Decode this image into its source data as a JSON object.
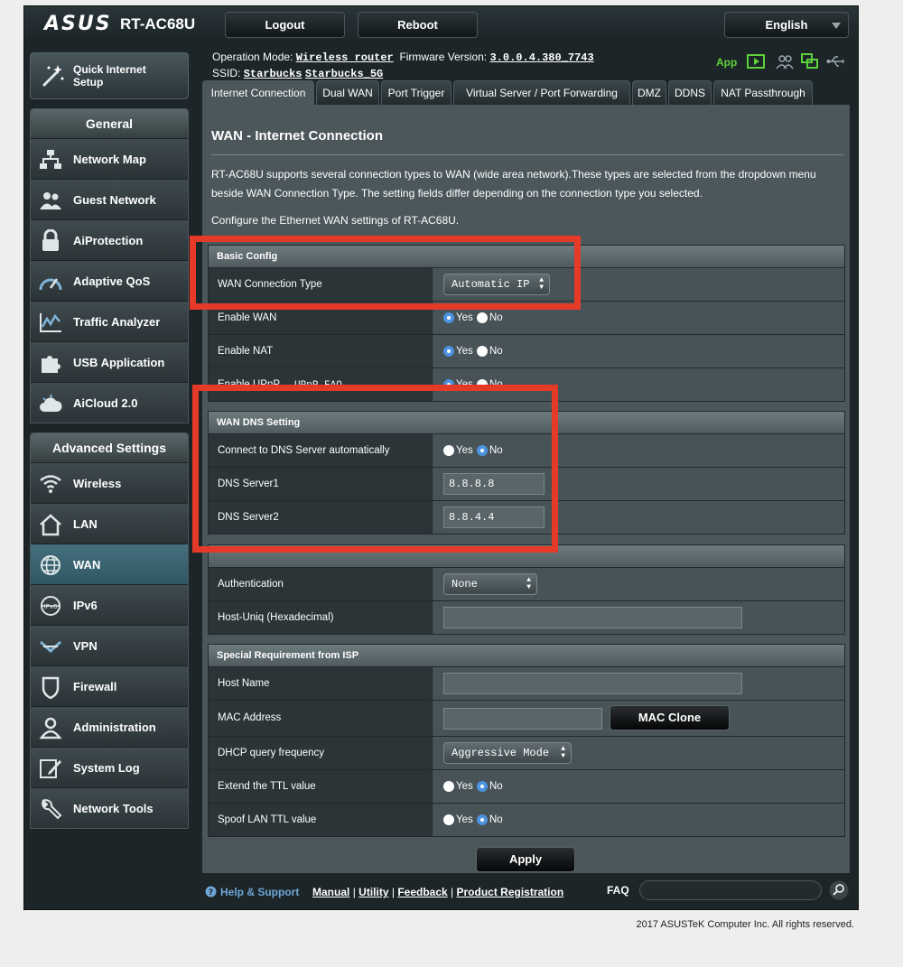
{
  "header": {
    "logo": "ASUS",
    "model": "RT-AC68U",
    "logout_label": "Logout",
    "reboot_label": "Reboot",
    "language": "English"
  },
  "status": {
    "op_mode_label": "Operation Mode:",
    "op_mode_value": "Wireless router",
    "firmware_label": "Firmware Version:",
    "firmware_value": "3.0.0.4.380_7743",
    "ssid_label": "SSID:",
    "ssid_1": "Starbucks",
    "ssid_2": "Starbucks_5G",
    "app_label": "App"
  },
  "sidebar": {
    "quick_setup": "Quick Internet Setup",
    "general_title": "General",
    "general_items": [
      "Network Map",
      "Guest Network",
      "AiProtection",
      "Adaptive QoS",
      "Traffic Analyzer",
      "USB Application",
      "AiCloud 2.0"
    ],
    "advanced_title": "Advanced Settings",
    "advanced_items": [
      "Wireless",
      "LAN",
      "WAN",
      "IPv6",
      "VPN",
      "Firewall",
      "Administration",
      "System Log",
      "Network Tools"
    ],
    "active_item": "WAN"
  },
  "tabs": [
    "Internet Connection",
    "Dual WAN",
    "Port Trigger",
    "Virtual Server / Port Forwarding",
    "DMZ",
    "DDNS",
    "NAT Passthrough"
  ],
  "page": {
    "title": "WAN - Internet Connection",
    "description": "RT-AC68U supports several connection types to WAN (wide area network).These types are selected from the dropdown menu beside WAN Connection Type. The setting fields differ depending on the connection type you selected.",
    "description2": "Configure the Ethernet WAN settings of RT-AC68U."
  },
  "basic_config": {
    "header": "Basic Config",
    "wan_type_label": "WAN Connection Type",
    "wan_type_value": "Automatic IP",
    "enable_wan_label": "Enable WAN",
    "enable_nat_label": "Enable NAT",
    "enable_upnp_label": "Enable UPnP",
    "upnp_faq": "UPnP FAQ",
    "yes": "Yes",
    "no": "No"
  },
  "dns": {
    "header": "WAN DNS Setting",
    "auto_label": "Connect to DNS Server automatically",
    "dns1_label": "DNS Server1",
    "dns1_value": "8.8.8.8",
    "dns2_label": "DNS Server2",
    "dns2_value": "8.8.4.4"
  },
  "account": {
    "auth_label": "Authentication",
    "auth_value": "None",
    "hostuniq_label": "Host-Uniq (Hexadecimal)"
  },
  "isp": {
    "header": "Special Requirement from ISP",
    "hostname_label": "Host Name",
    "mac_label": "MAC Address",
    "mac_clone": "MAC Clone",
    "dhcp_label": "DHCP query frequency",
    "dhcp_value": "Aggressive Mode",
    "ttl_label": "Extend the TTL value",
    "spoof_label": "Spoof LAN TTL value"
  },
  "apply_label": "Apply",
  "footer": {
    "help": "Help & Support",
    "manual": "Manual",
    "utility": "Utility",
    "feedback": "Feedback",
    "registration": "Product Registration",
    "faq": "FAQ",
    "sep": "|"
  },
  "copyright": "2017 ASUSTeK Computer Inc. All rights reserved.",
  "colors": {
    "highlight": "#e53a27",
    "radio_on": "#4c93e0",
    "app_green": "#5fd13a"
  }
}
